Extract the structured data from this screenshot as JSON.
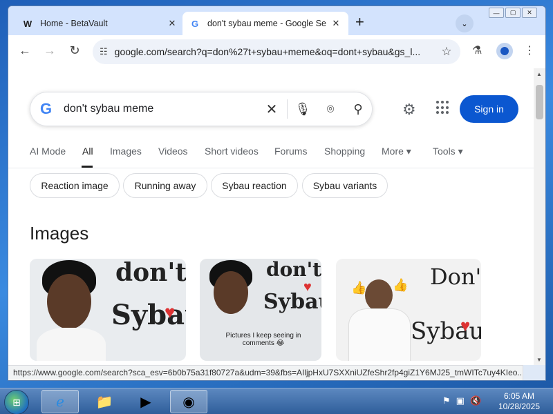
{
  "browser": {
    "tabs": [
      {
        "title": "Home - BetaVault",
        "favicon": "W",
        "active": false
      },
      {
        "title": "don't sybau meme - Google Se",
        "favicon": "G",
        "active": true
      }
    ],
    "new_tab": "+",
    "url": "google.com/search?q=don%27t+sybau+meme&oq=dont+sybau&gs_l..."
  },
  "search": {
    "query": "don't sybau meme",
    "sign_in": "Sign in",
    "tabs": [
      "AI Mode",
      "All",
      "Images",
      "Videos",
      "Short videos",
      "Forums",
      "Shopping",
      "More",
      "Tools"
    ],
    "chips": [
      "Reaction image",
      "Running away",
      "Sybau reaction",
      "Sybau variants"
    ],
    "section_title": "Images",
    "images": [
      {
        "caption_line1": "don't",
        "caption_line2": "Sybau"
      },
      {
        "caption_line1": "don't",
        "caption_line2": "Sybau",
        "subtext": "Pictures I keep seeing in comments 😂"
      },
      {
        "caption_line1": "Don't",
        "caption_line2": "Sybau"
      }
    ]
  },
  "status_url": "https://www.google.com/search?sca_esv=6b0b75a31f80727a&udm=39&fbs=AIljpHxU7SXXniUZfeShr2fp4giZ1Y6MJ25_tmWITc7uy4KIeo...",
  "taskbar": {
    "time": "6:05 AM",
    "date": "10/28/2025"
  },
  "colors": {
    "signin_bg": "#0b57d0",
    "accent_heart": "#dd3333"
  }
}
